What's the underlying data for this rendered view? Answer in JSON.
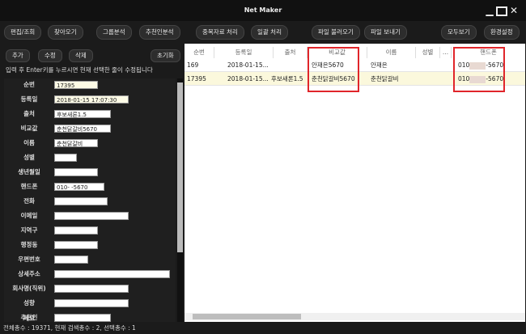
{
  "window": {
    "title": "Net Maker"
  },
  "toolbar": {
    "buttons": [
      "편집/조회",
      "찾아오기",
      "그룹분석",
      "추천인분석",
      "중복자료 처리",
      "일괄 처리",
      "파일 불러오기",
      "파일 보내기",
      "모두보기",
      "환경설정"
    ]
  },
  "left": {
    "add": "추가",
    "edit": "수정",
    "delete": "삭제",
    "reset": "초기화",
    "hint": "입력 후 Enter키를 누르시면 현재 선택한 줄이 수정됩니다",
    "fields": [
      {
        "label": "순번",
        "value": "17395"
      },
      {
        "label": "등록일",
        "value": "2018-01-15 17:07:30"
      },
      {
        "label": "출처",
        "value": "후보새론1.5"
      },
      {
        "label": "비교값",
        "value": "춘천닭갈비5670"
      },
      {
        "label": "이름",
        "value": "춘천닭갈비"
      },
      {
        "label": "성별",
        "value": ""
      },
      {
        "label": "생년월일",
        "value": ""
      },
      {
        "label": "핸드폰",
        "value": "010-      -5670"
      },
      {
        "label": "전화",
        "value": ""
      },
      {
        "label": "이메일",
        "value": ""
      },
      {
        "label": "지역구",
        "value": ""
      },
      {
        "label": "행정동",
        "value": ""
      },
      {
        "label": "우편번호",
        "value": ""
      },
      {
        "label": "상세주소",
        "value": ""
      },
      {
        "label": "회사명(직위)",
        "value": ""
      },
      {
        "label": "성향",
        "value": ""
      },
      {
        "label": "추천인",
        "value": ""
      },
      {
        "label": "메모",
        "value": ""
      }
    ]
  },
  "grid": {
    "headers": [
      "순번",
      "등록일",
      "출처",
      "비교값",
      "이름",
      "성별",
      "...",
      "핸드폰"
    ],
    "rows": [
      {
        "seq": "169",
        "date": "2018-01-15...",
        "source": "",
        "compare": "안재은5670",
        "name": "안재은",
        "gender": "",
        "more": "",
        "phone_pre": "010",
        "phone_post": "-5670"
      },
      {
        "seq": "17395",
        "date": "2018-01-15...",
        "source": "후보새론1.5",
        "compare": "춘천닭갈비5670",
        "name": "춘천닭갈비",
        "gender": "",
        "more": "",
        "phone_pre": "010",
        "phone_post": "-5670"
      }
    ]
  },
  "status": {
    "text": "전체총수 : 19371, 현재 검색총수 : 2, 선택총수 : 1"
  },
  "colors": {
    "highlight": "#e0252a",
    "selected_row": "#fbf8dc"
  }
}
